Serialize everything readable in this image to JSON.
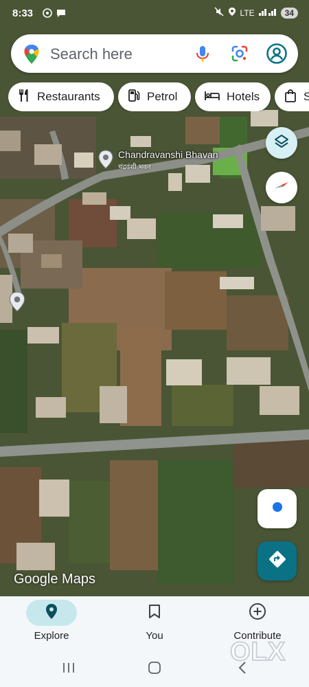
{
  "status_bar": {
    "time": "8:33",
    "network": "LTE",
    "battery": "34"
  },
  "search": {
    "placeholder": "Search here"
  },
  "chips": [
    {
      "label": "Restaurants",
      "icon": "restaurant-icon"
    },
    {
      "label": "Petrol",
      "icon": "petrol-icon"
    },
    {
      "label": "Hotels",
      "icon": "hotel-icon"
    },
    {
      "label": "S",
      "icon": "shopping-icon"
    }
  ],
  "map": {
    "place_name": "Chandravanshi Bhavan",
    "place_subtitle": "चंद्रवंशी भवन",
    "watermark": "Google Maps"
  },
  "bottom_nav": [
    {
      "label": "Explore",
      "icon": "explore-pin-icon",
      "active": true
    },
    {
      "label": "You",
      "icon": "bookmark-icon",
      "active": false
    },
    {
      "label": "Contribute",
      "icon": "add-circle-icon",
      "active": false
    }
  ],
  "colors": {
    "accent": "#0b7285",
    "active_nav": "#c6e8ed",
    "location_dot": "#1a73e8"
  },
  "overlay_watermark": "OLX"
}
